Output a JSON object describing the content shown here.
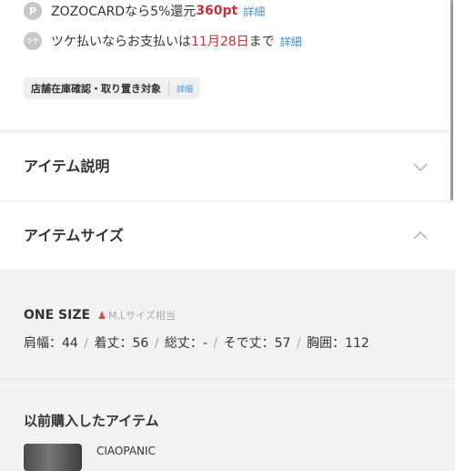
{
  "promo": {
    "zozocard": {
      "icon": "P",
      "text": "ZOZOCARDなら5%還元 ",
      "points": "360pt",
      "link": "詳細"
    },
    "tsuke": {
      "icon": "ツケ",
      "text_before": "ツケ払いならお支払いは",
      "date": "11月28日",
      "text_after": "まで",
      "link": "詳細"
    }
  },
  "store_check": {
    "label": "店舗在庫確認・取り置き対象",
    "link": "詳細"
  },
  "accordion": {
    "description": {
      "label": "アイテム説明",
      "icon": "chevron-down-icon"
    },
    "size": {
      "label": "アイテムサイズ",
      "icon": "chevron-up-icon"
    }
  },
  "size": {
    "name": "ONE SIZE",
    "note": "M,Lサイズ相当",
    "measurements": [
      {
        "text": "肩幅：44"
      },
      {
        "text": "着丈：56"
      },
      {
        "text": "総丈：-"
      },
      {
        "text": "そで丈：57"
      },
      {
        "text": "胸囲：112"
      }
    ],
    "separator": "/"
  },
  "previous": {
    "title": "以前購入したアイテム",
    "brand": "CIAOPANIC"
  },
  "colors": {
    "accent_red": "#c8313c",
    "link_blue": "#3a8fd8"
  }
}
